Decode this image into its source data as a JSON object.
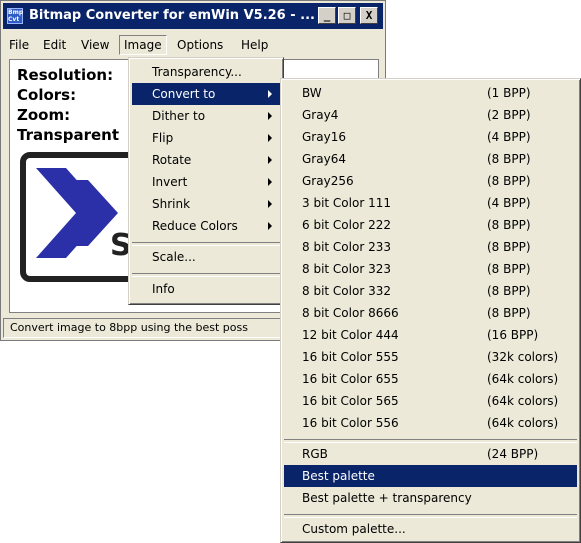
{
  "window": {
    "app_icon_text": "Bmp Cvt",
    "title": "Bitmap Converter for emWin V5.26 - ...",
    "controls": {
      "minimize": "_",
      "maximize": "□",
      "close": "X"
    }
  },
  "menubar": [
    {
      "label": "File"
    },
    {
      "label": "Edit"
    },
    {
      "label": "View"
    },
    {
      "label": "Image"
    },
    {
      "label": "Options"
    },
    {
      "label": "Help"
    }
  ],
  "info": {
    "resolution": "Resolution:",
    "colors": "Colors:",
    "zoom": "Zoom:",
    "transparent": "Transparent"
  },
  "logo": {
    "text": "SE"
  },
  "statusbar": "Convert image to 8bpp using the best poss",
  "image_menu": [
    {
      "label": "Transparency..."
    },
    {
      "label": "Convert to"
    },
    {
      "label": "Dither to"
    },
    {
      "label": "Flip"
    },
    {
      "label": "Rotate"
    },
    {
      "label": "Invert"
    },
    {
      "label": "Shrink"
    },
    {
      "label": "Reduce Colors"
    },
    {
      "label": "Scale..."
    },
    {
      "label": "Info"
    }
  ],
  "convert_menu": [
    {
      "label": "BW",
      "bpp": "(1 BPP)"
    },
    {
      "label": "Gray4",
      "bpp": "(2 BPP)"
    },
    {
      "label": "Gray16",
      "bpp": "(4 BPP)"
    },
    {
      "label": "Gray64",
      "bpp": "(8 BPP)"
    },
    {
      "label": "Gray256",
      "bpp": "(8 BPP)"
    },
    {
      "label": "3 bit Color 111",
      "bpp": "(4 BPP)"
    },
    {
      "label": "6 bit Color 222",
      "bpp": "(8 BPP)"
    },
    {
      "label": "8 bit Color 233",
      "bpp": "(8 BPP)"
    },
    {
      "label": "8 bit Color 323",
      "bpp": "(8 BPP)"
    },
    {
      "label": "8 bit Color 332",
      "bpp": "(8 BPP)"
    },
    {
      "label": "8 bit Color 8666",
      "bpp": "(8 BPP)"
    },
    {
      "label": "12 bit Color 444",
      "bpp": "(16 BPP)"
    },
    {
      "label": "16 bit Color 555",
      "bpp": "(32k colors)"
    },
    {
      "label": "16 bit Color 655",
      "bpp": "(64k colors)"
    },
    {
      "label": "16 bit Color 565",
      "bpp": "(64k colors)"
    },
    {
      "label": "16 bit Color 556",
      "bpp": "(64k colors)"
    },
    {
      "label": "RGB",
      "bpp": "(24 BPP)"
    },
    {
      "label": "Best palette",
      "bpp": ""
    },
    {
      "label": "Best palette + transparency",
      "bpp": ""
    },
    {
      "label": "Custom palette...",
      "bpp": ""
    }
  ],
  "colors": {
    "highlight": "#0a246a",
    "menu_bg": "#ece9d8",
    "logo_blue": "#2b2fa8"
  }
}
